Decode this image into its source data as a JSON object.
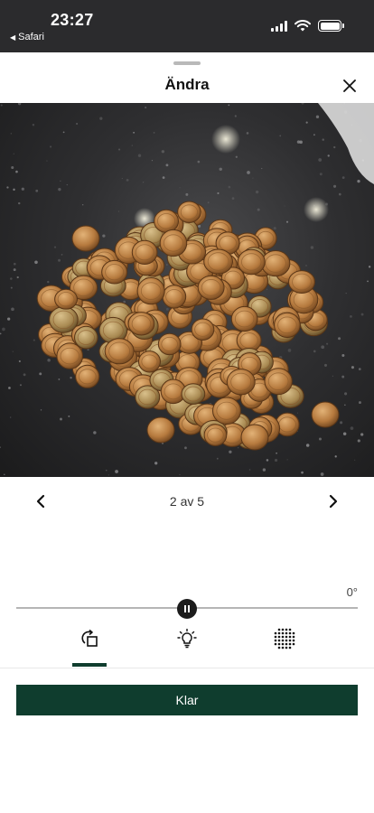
{
  "status_bar": {
    "time": "23:27",
    "back_app": "Safari",
    "battery_level": 1.0,
    "icons": [
      "signal-icon",
      "wifi-icon",
      "battery-icon"
    ]
  },
  "header": {
    "title": "Ändra",
    "close_icon": "close-icon"
  },
  "photo": {
    "subject": "coins-photo"
  },
  "pager": {
    "label": "2 av 5",
    "prev_icon": "chevron-left-icon",
    "next_icon": "chevron-right-icon"
  },
  "rotation": {
    "angle_label": "0°",
    "value_fraction": 0.5
  },
  "tools": [
    {
      "name": "rotate",
      "icon": "rotate-icon",
      "selected": true
    },
    {
      "name": "brightness",
      "icon": "lightbulb-icon",
      "selected": false
    },
    {
      "name": "sharpness",
      "icon": "dot-grid-icon",
      "selected": false
    }
  ],
  "done_button": {
    "label": "Klar"
  },
  "colors": {
    "accent": "#0f3d2e",
    "status_bar_bg": "#2b2b2d"
  }
}
